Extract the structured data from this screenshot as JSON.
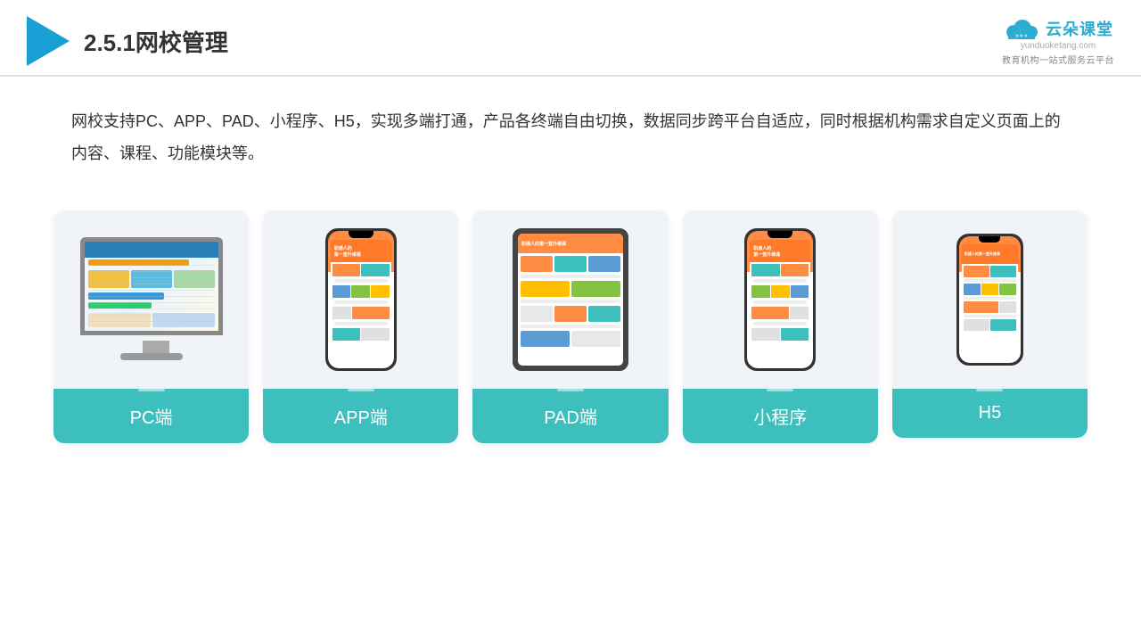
{
  "header": {
    "title": "2.5.1网校管理",
    "brand": {
      "name": "云朵课堂",
      "name_pinyin": "yunduoketang.com",
      "tagline": "教育机构一站式服务云平台"
    }
  },
  "description": "网校支持PC、APP、PAD、小程序、H5，实现多端打通，产品各终端自由切换，数据同步跨平台自适应，同时根据机构需求自定义页面上的内容、课程、功能模块等。",
  "cards": [
    {
      "id": "pc",
      "label": "PC端"
    },
    {
      "id": "app",
      "label": "APP端"
    },
    {
      "id": "pad",
      "label": "PAD端"
    },
    {
      "id": "miniprogram",
      "label": "小程序"
    },
    {
      "id": "h5",
      "label": "H5"
    }
  ],
  "colors": {
    "teal": "#3dbfbe",
    "accent_blue": "#1a9fd4",
    "text_main": "#333333"
  }
}
